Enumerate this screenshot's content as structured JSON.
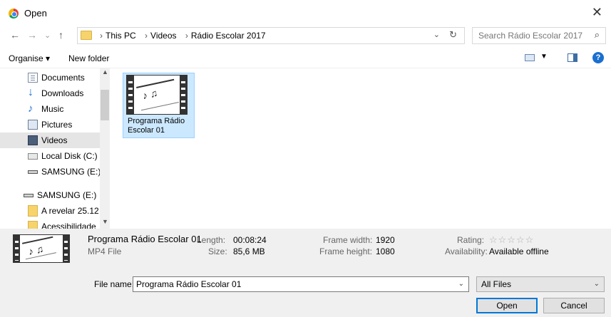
{
  "window": {
    "title": "Open",
    "close_glyph": "✕"
  },
  "nav": {
    "back": "←",
    "forward": "→",
    "recent": "⌄",
    "up": "↑",
    "breadcrumbs": [
      "This PC",
      "Videos",
      "Rádio Escolar 2017"
    ],
    "breadcrumb_sep": "›",
    "search_placeholder": "Search Rádio Escolar 2017"
  },
  "toolbar": {
    "organise": "Organise ▾",
    "new_folder": "New folder",
    "help": "?"
  },
  "sidebar": {
    "items": [
      {
        "label": "Documents",
        "icon": "document-icon"
      },
      {
        "label": "Downloads",
        "icon": "download-icon"
      },
      {
        "label": "Music",
        "icon": "music-icon"
      },
      {
        "label": "Pictures",
        "icon": "pictures-icon"
      },
      {
        "label": "Videos",
        "icon": "videos-icon",
        "selected": true
      },
      {
        "label": "Local Disk (C:)",
        "icon": "disk-icon"
      },
      {
        "label": "SAMSUNG (E:)",
        "icon": "usb-drive-icon"
      },
      {
        "label": "SAMSUNG (E:)",
        "icon": "usb-drive-icon"
      },
      {
        "label": "A revelar 25.12",
        "icon": "folder-icon"
      },
      {
        "label": "Acessibilidade",
        "icon": "folder-icon"
      }
    ]
  },
  "files": [
    {
      "name": "Programa Rádio Escolar 01",
      "type": "video"
    }
  ],
  "details": {
    "name": "Programa Rádio Escolar 01",
    "type": "MP4 File",
    "length_key": "Length:",
    "length": "00:08:24",
    "size_key": "Size:",
    "size": "85,6 MB",
    "frame_width_key": "Frame width:",
    "frame_width": "1920",
    "frame_height_key": "Frame height:",
    "frame_height": "1080",
    "rating_key": "Rating:",
    "rating_stars": "☆☆☆☆☆",
    "rating": 0,
    "availability_key": "Availability:",
    "availability": "Available offline"
  },
  "bottom": {
    "file_name_label": "File name:",
    "file_name_value": "Programa Rádio Escolar 01",
    "filter": "All Files",
    "open": "Open",
    "cancel": "Cancel"
  }
}
